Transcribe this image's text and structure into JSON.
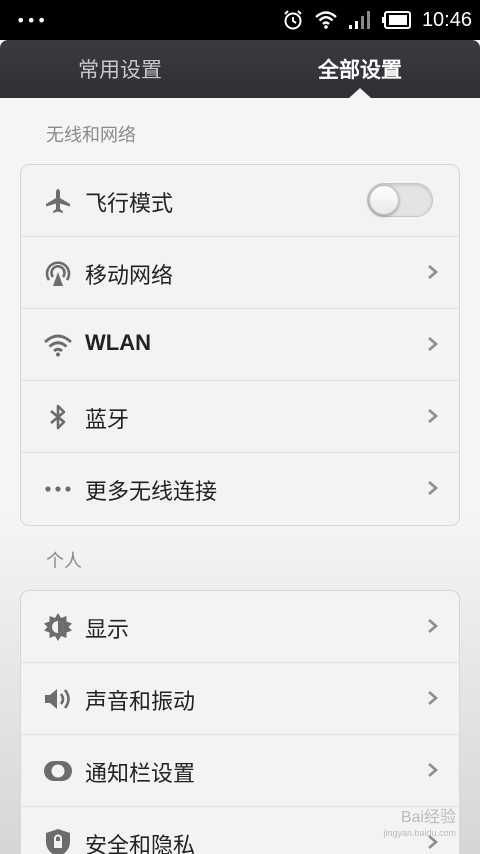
{
  "status_bar": {
    "time": "10:46",
    "dots": "•••"
  },
  "tabs": [
    {
      "label": "常用设置",
      "active": false
    },
    {
      "label": "全部设置",
      "active": true
    }
  ],
  "sections": [
    {
      "title": "无线和网络",
      "items": [
        {
          "label": "飞行模式",
          "icon": "airplane-icon",
          "control": "toggle",
          "toggle_on": false
        },
        {
          "label": "移动网络",
          "icon": "mobile-network-icon",
          "control": "chevron"
        },
        {
          "label": "WLAN",
          "icon": "wifi-icon",
          "control": "chevron"
        },
        {
          "label": "蓝牙",
          "icon": "bluetooth-icon",
          "control": "chevron"
        },
        {
          "label": "更多无线连接",
          "icon": "more-dots-icon",
          "control": "chevron"
        }
      ]
    },
    {
      "title": "个人",
      "items": [
        {
          "label": "显示",
          "icon": "brightness-icon",
          "control": "chevron"
        },
        {
          "label": "声音和振动",
          "icon": "speaker-icon",
          "control": "chevron"
        },
        {
          "label": "通知栏设置",
          "icon": "notification-icon",
          "control": "chevron"
        },
        {
          "label": "安全和隐私",
          "icon": "shield-icon",
          "control": "chevron"
        }
      ]
    }
  ],
  "watermark": {
    "brand": "Bai",
    "brand2": "经验",
    "url": "jingyan.baidu.com"
  },
  "colors": {
    "tabbar": "#333439",
    "background": "#f5f5f5",
    "text": "#222222",
    "section_title": "#8a8a8a"
  }
}
